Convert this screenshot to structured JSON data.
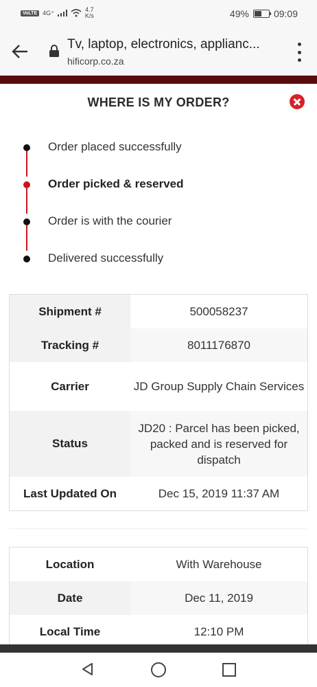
{
  "status_bar": {
    "network": "VoLTE",
    "signal": "4G⁺",
    "speed_value": "4.7",
    "speed_unit": "K/s",
    "battery": "49%",
    "battery_level": 0.49,
    "time": "09:09"
  },
  "browser": {
    "page_title": "Tv, laptop, electronics, applianc...",
    "domain": "hificorp.co.za"
  },
  "modal": {
    "title": "WHERE IS MY ORDER?",
    "steps": [
      {
        "label": "Order placed successfully",
        "active": false
      },
      {
        "label": "Order picked & reserved",
        "active": true
      },
      {
        "label": "Order is with the courier",
        "active": false
      },
      {
        "label": "Delivered successfully",
        "active": false
      }
    ],
    "shipment_table": [
      {
        "key": "Shipment #",
        "value": "500058237"
      },
      {
        "key": "Tracking #",
        "value": "8011176870"
      },
      {
        "key": "Carrier",
        "value": "JD Group Supply Chain Services"
      },
      {
        "key": "Status",
        "value": "JD20 : Parcel has been picked, packed and is reserved for dispatch"
      },
      {
        "key": "Last Updated On",
        "value": "Dec 15, 2019 11:37 AM"
      }
    ],
    "location_table": [
      {
        "key": "Location",
        "value": "With Warehouse"
      },
      {
        "key": "Date",
        "value": "Dec 11, 2019"
      },
      {
        "key": "Local Time",
        "value": "12:10 PM"
      }
    ]
  }
}
